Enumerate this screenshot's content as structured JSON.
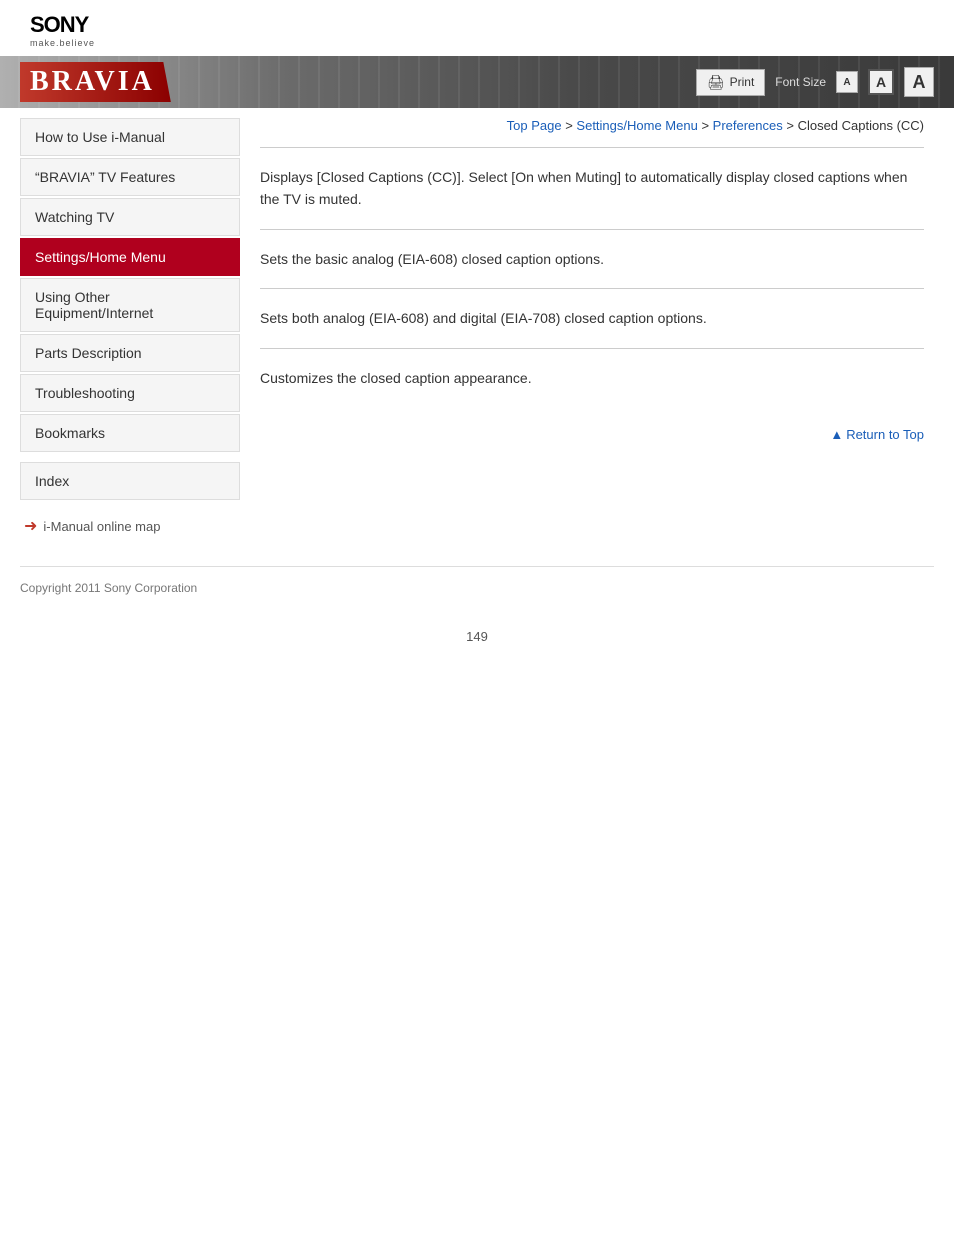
{
  "header": {
    "brand": "SONY",
    "tagline": "make.believe",
    "banner_title": "BRAVIA"
  },
  "toolbar": {
    "print_label": "Print",
    "font_size_label": "Font Size",
    "font_small": "A",
    "font_medium": "A",
    "font_large": "A"
  },
  "breadcrumb": {
    "top_page": "Top Page",
    "separator1": " > ",
    "settings_menu": "Settings/Home Menu",
    "separator2": " > ",
    "preferences": "Preferences",
    "separator3": " >  Closed Captions (CC)"
  },
  "sidebar": {
    "items": [
      {
        "id": "how-to-use",
        "label": "How to Use i-Manual",
        "active": false
      },
      {
        "id": "bravia-features",
        "label": "“BRAVIA” TV Features",
        "active": false
      },
      {
        "id": "watching-tv",
        "label": "Watching TV",
        "active": false
      },
      {
        "id": "settings-home",
        "label": "Settings/Home Menu",
        "active": true
      },
      {
        "id": "using-other",
        "label": "Using Other Equipment/Internet",
        "active": false
      },
      {
        "id": "parts-description",
        "label": "Parts Description",
        "active": false
      },
      {
        "id": "troubleshooting",
        "label": "Troubleshooting",
        "active": false
      },
      {
        "id": "bookmarks",
        "label": "Bookmarks",
        "active": false
      }
    ],
    "index_label": "Index",
    "online_map_label": "i-Manual online map"
  },
  "content": {
    "sections": [
      {
        "id": "section1",
        "text": "Displays [Closed Captions (CC)]. Select [On when Muting] to automatically display closed captions when the TV is muted."
      },
      {
        "id": "section2",
        "text": "Sets the basic analog (EIA-608) closed caption options."
      },
      {
        "id": "section3",
        "text": "Sets both analog (EIA-608) and digital (EIA-708) closed caption options."
      },
      {
        "id": "section4",
        "text": "Customizes the closed caption appearance."
      }
    ],
    "return_to_top": "Return to Top"
  },
  "footer": {
    "copyright": "Copyright 2011 Sony Corporation"
  },
  "page": {
    "number": "149"
  }
}
